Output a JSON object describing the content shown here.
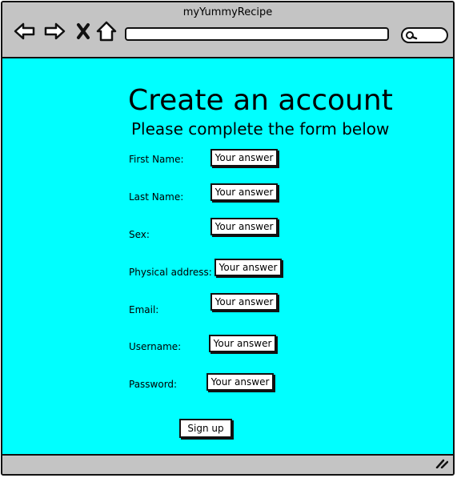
{
  "window": {
    "title": "myYummyRecipe"
  },
  "browser": {
    "back_icon": "back-arrow-icon",
    "forward_icon": "forward-arrow-icon",
    "close_icon": "close-icon",
    "home_icon": "home-icon",
    "search_icon": "search-icon",
    "url": ""
  },
  "form": {
    "title": "Create an account",
    "subtitle": "Please complete the form below",
    "placeholder": "Your answer",
    "fields": [
      {
        "label": "First Name:"
      },
      {
        "label": "Last Name:"
      },
      {
        "label": "Sex:"
      },
      {
        "label": "Physical address:"
      },
      {
        "label": "Email:"
      },
      {
        "label": "Username:"
      },
      {
        "label": "Password:"
      }
    ],
    "submit_label": "Sign up"
  },
  "colors": {
    "content_background": "#00ffff",
    "chrome": "#c4c4c4"
  }
}
